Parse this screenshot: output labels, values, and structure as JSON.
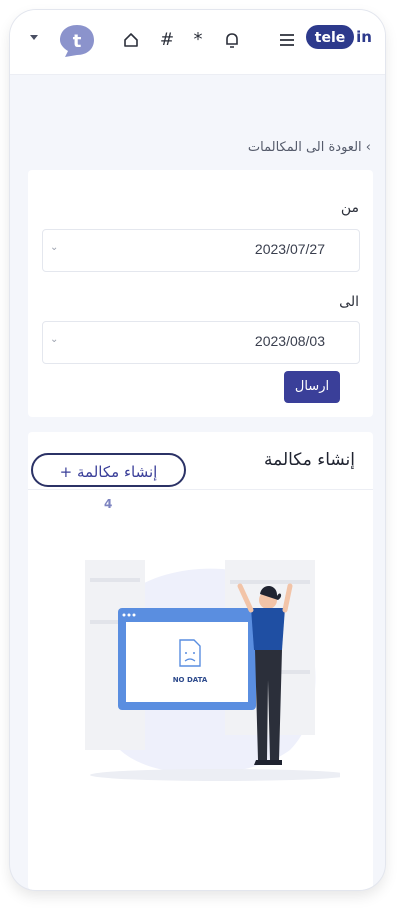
{
  "header": {
    "logo_text": "tele in",
    "avatar_letter": "t",
    "icons": [
      "menu-icon",
      "bell-icon",
      "asterisk-icon",
      "hash-icon",
      "home-icon",
      "dropdown-caret-icon"
    ],
    "hash_glyph": "#",
    "asterisk_glyph": "*"
  },
  "breadcrumb": {
    "chevron": "›",
    "label": "العودة الى المكالمات"
  },
  "filter": {
    "from_label": "من",
    "from_value": "2023/07/27",
    "to_label": "الى",
    "to_value": "2023/08/03",
    "submit_label": "ارسال"
  },
  "create_section": {
    "title": "إنشاء مكالمة",
    "button_label": "+ إنشاء مكالمة",
    "step_badge": "4"
  },
  "empty_state": {
    "text": "NO DATA"
  },
  "colors": {
    "brand": "#2d3a8c",
    "accent": "#3a3f99",
    "page_bg": "#f4f6fb",
    "figure_top": "#1f4fa3"
  }
}
